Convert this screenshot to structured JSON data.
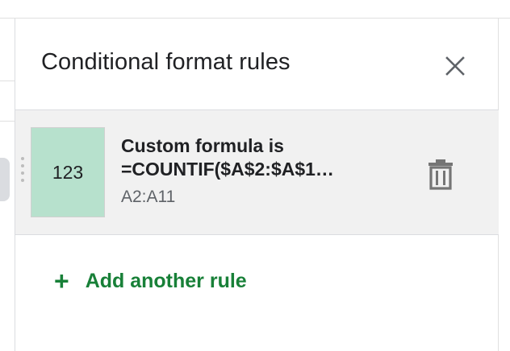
{
  "panel": {
    "title": "Conditional format rules"
  },
  "rule": {
    "preview_text": "123",
    "preview_color": "#b7e1cd",
    "condition_line1": "Custom formula is",
    "condition_line2": "=COUNTIF($A$2:$A$1…",
    "range": "A2:A11"
  },
  "actions": {
    "add_rule_icon": "+",
    "add_rule_label": "Add another rule"
  },
  "icons": {
    "close": "close-icon",
    "delete": "trash-icon",
    "drag": "drag-handle-icon"
  },
  "colors": {
    "accent_green": "#188038",
    "card_bg": "#f1f1f1"
  }
}
